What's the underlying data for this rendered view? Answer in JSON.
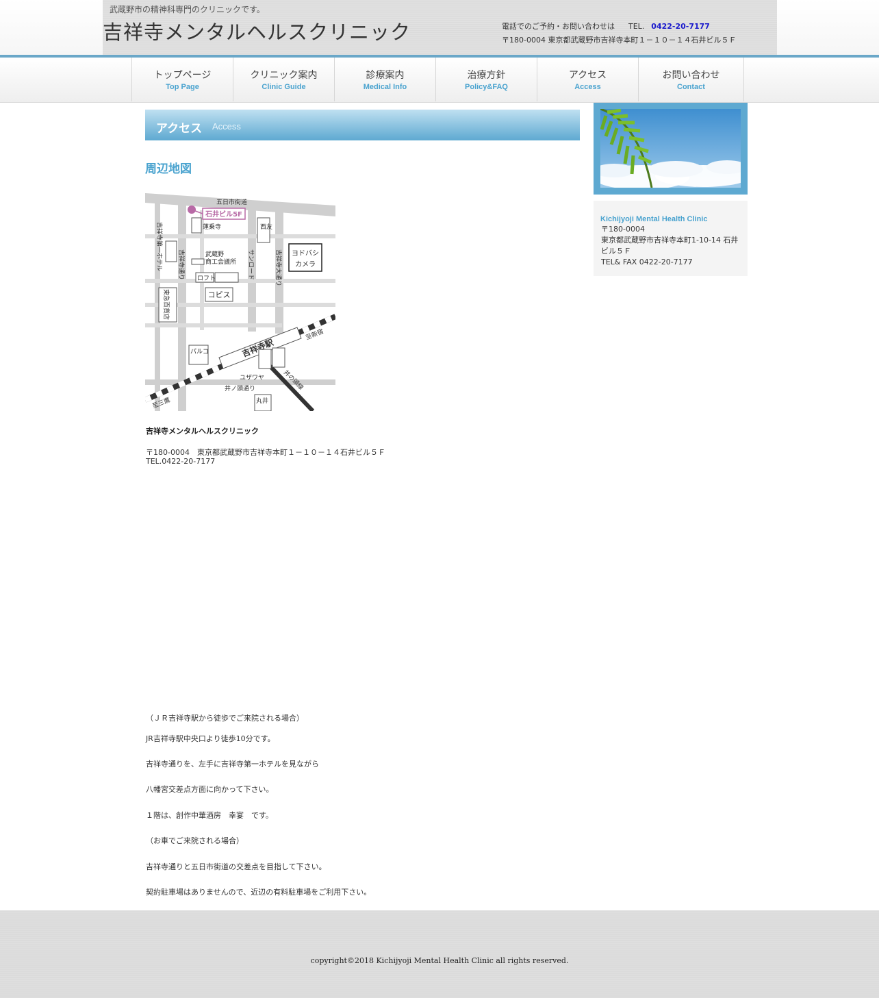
{
  "header": {
    "tagline": "武蔵野市の精神科専門のクリニックです。",
    "site_title": "吉祥寺メンタルヘルスクリニック",
    "contact_prefix": "電話でのご予約・お問い合わせは",
    "tel_label": "TEL.",
    "tel_number": "0422-20-7177",
    "address": "〒180-0004 東京都武蔵野市吉祥寺本町１－１０－１４石井ビル５Ｆ"
  },
  "nav": {
    "items": [
      {
        "jp": "トップページ",
        "en": "Top Page"
      },
      {
        "jp": "クリニック案内",
        "en": "Clinic Guide"
      },
      {
        "jp": "診療案内",
        "en": "Medical Info"
      },
      {
        "jp": "治療方針",
        "en": "Policy&FAQ"
      },
      {
        "jp": "アクセス",
        "en": "Access"
      },
      {
        "jp": "お問い合わせ",
        "en": "Contact"
      }
    ]
  },
  "main": {
    "heading_jp": "アクセス",
    "heading_en": "Access",
    "section_title": "周辺地図",
    "map": {
      "roads": [
        "五日市街道",
        "吉祥寺通り",
        "サンロード",
        "吉祥寺大通り",
        "井ノ頭通り",
        "井の頭線"
      ],
      "buildings": [
        "石井ビル5F",
        "蓮乗寺",
        "西友",
        "武蔵野",
        "商工会議所",
        "ヨドバシ",
        "カメラ",
        "ロフト",
        "コピス",
        "吉祥寺第一ホテル",
        "東急百貨店",
        "パルコ",
        "ユザワヤ",
        "丸井"
      ],
      "station": "吉祥寺駅",
      "to_shinjuku": "至新宿",
      "to_mitaka": "至三鷹"
    },
    "clinic_name": "吉祥寺メンタルヘルスクリニック",
    "clinic_address": "〒180-0004　東京都武蔵野市吉祥寺本町１－１０－１４石井ビル５Ｆ",
    "clinic_tel": "TEL.0422-20-7177",
    "directions": [
      "（ＪＲ吉祥寺駅から徒歩でご来院される場合）",
      "JR吉祥寺駅中央口より徒歩10分です。",
      "吉祥寺通りを、左手に吉祥寺第一ホテルを見ながら",
      "八幡宮交差点方面に向かって下さい。",
      "１階は、創作中華酒房　幸宴　です。",
      "（お車でご来院される場合）",
      "吉祥寺通りと五日市街道の交差点を目指して下さい。",
      "契約駐車場はありませんので、近辺の有料駐車場をご利用下さい。"
    ]
  },
  "sidebar": {
    "clinic_name_en": "Kichijyoji Mental Health Clinic",
    "postal": "〒180-0004",
    "address": "東京都武蔵野市吉祥寺本町1-10-14 石井ビル５Ｆ",
    "tel_fax": "TEL& FAX 0422-20-7177"
  },
  "footer": {
    "copyright": "copyright©2018 Kichijyoji Mental Health Clinic all rights reserved."
  },
  "colors": {
    "accent": "#4aa3cf",
    "blue_line": "#6aa7c8",
    "tel": "#1a1acc"
  }
}
